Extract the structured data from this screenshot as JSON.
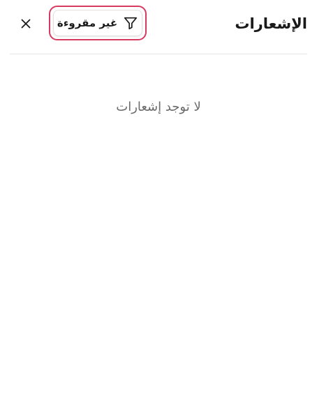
{
  "header": {
    "title": "الإشعارات",
    "filter": {
      "label": "غير مقروءة",
      "icon": "filter-icon",
      "focus_color": "#d63a5f"
    },
    "close": {
      "icon": "close-icon"
    }
  },
  "main": {
    "empty_message": "لا توجد إشعارات"
  }
}
